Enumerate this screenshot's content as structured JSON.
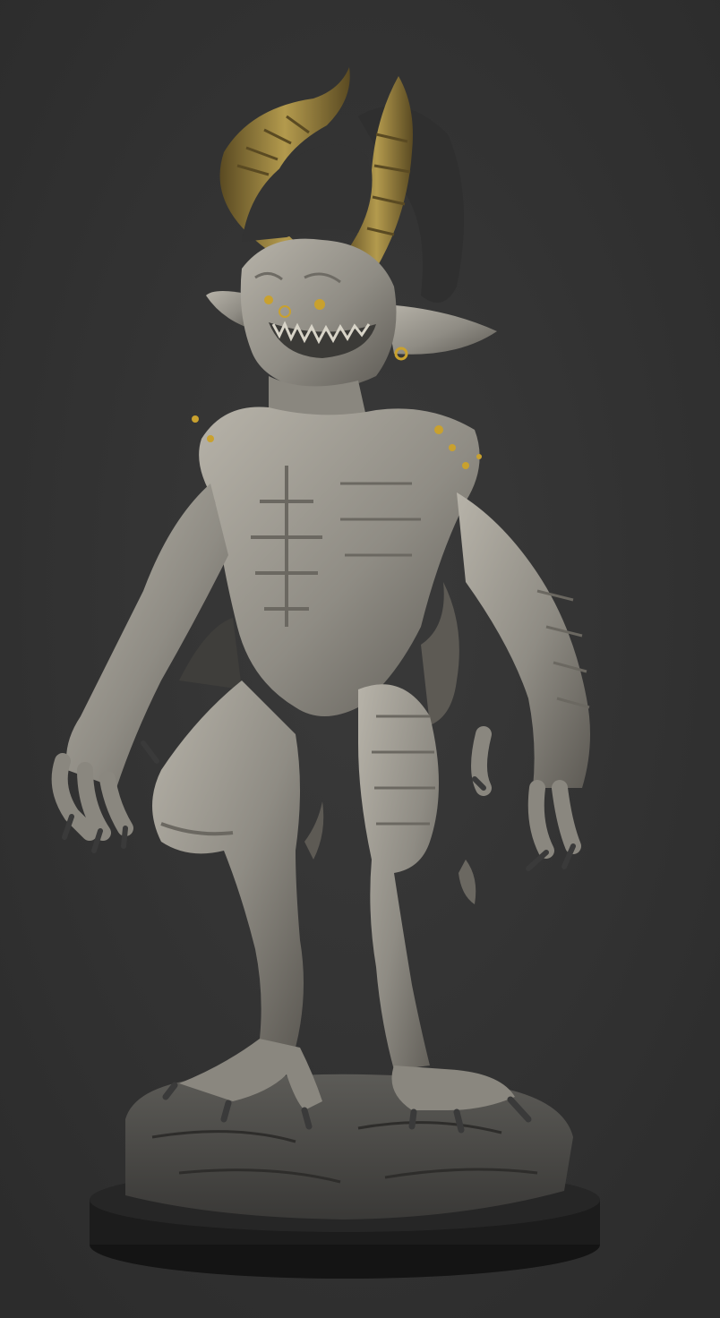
{
  "scene": {
    "background": "#333333",
    "skin": "#8f8c84",
    "skin_light": "#b7b3a9",
    "skin_dark": "#5d5a54",
    "horn": "#9e8641",
    "horn_dark": "#5a4a22",
    "hair": "#2f2f2f",
    "claw": "#3a3a3a",
    "rock": "#4d4c49",
    "base": "#1c1c1c",
    "accent_gold": "#c9a12e"
  }
}
